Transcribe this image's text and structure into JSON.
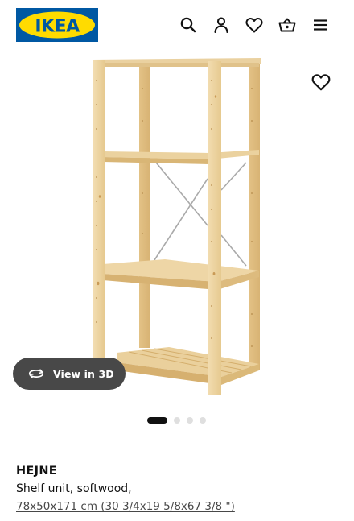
{
  "header": {
    "logo_text": "IKEA",
    "icons": [
      "search-icon",
      "account-icon",
      "favourites-icon",
      "basket-icon",
      "menu-icon"
    ]
  },
  "gallery": {
    "favourite_icon": "heart-outline-icon",
    "view_3d_label": "View in 3D",
    "view_3d_icon": "rotate-3d-icon",
    "image_count": 4,
    "active_image": 1
  },
  "product": {
    "name": "HEJNE",
    "description": "Shelf unit, softwood,",
    "size": "78x50x171 cm (30 3/4x19 5/8x67 3/8 \")"
  },
  "colors": {
    "brand_blue": "#0058A3",
    "brand_yellow": "#FFDB00",
    "button_dark": "#484848",
    "wood": "#E9CE9A"
  }
}
